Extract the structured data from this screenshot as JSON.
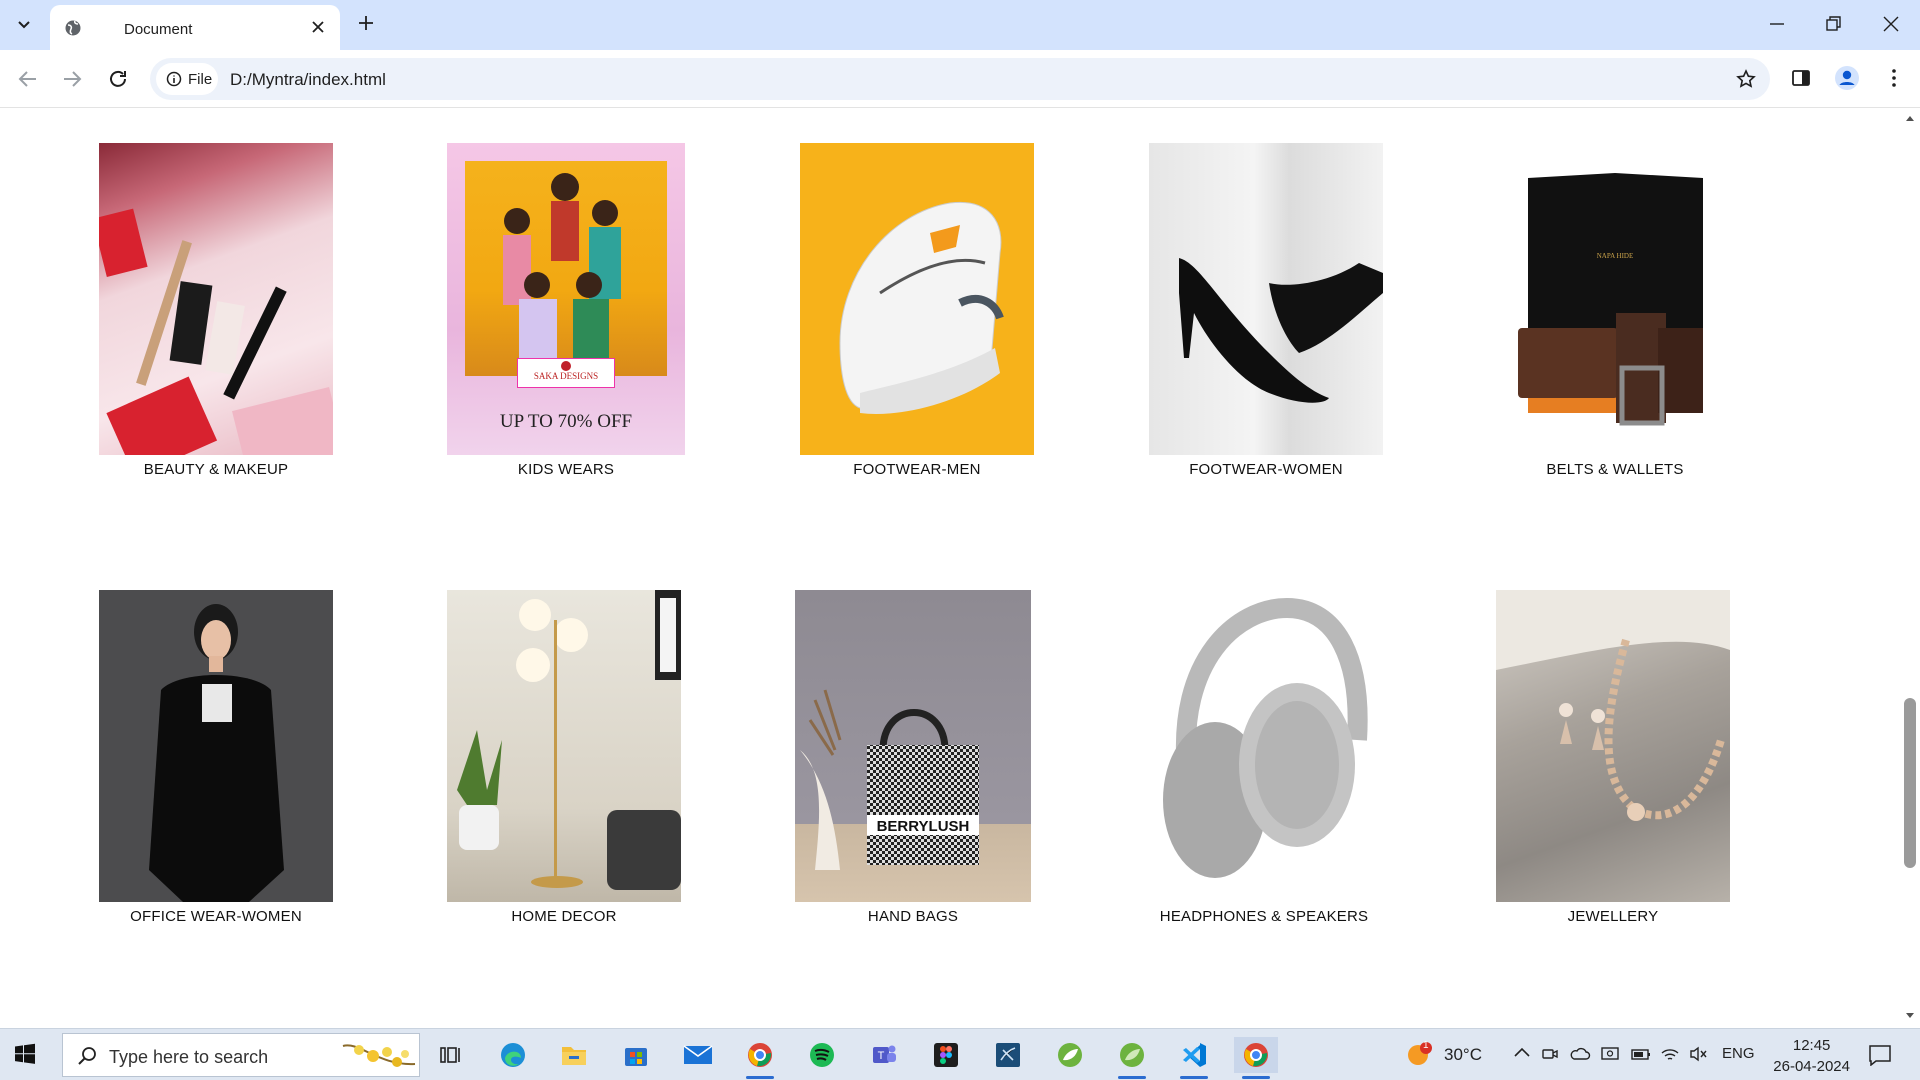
{
  "browser": {
    "tab_title": "Document",
    "address_chip": "File",
    "url": "D:/Myntra/index.html"
  },
  "page": {
    "categories": [
      {
        "label": "BEAUTY & MAKEUP",
        "img": "beauty"
      },
      {
        "label": "KIDS WEARS",
        "img": "kids"
      },
      {
        "label": "FOOTWEAR-MEN",
        "img": "footmen"
      },
      {
        "label": "FOOTWEAR-WOMEN",
        "img": "footwomen"
      },
      {
        "label": "BELTS & WALLETS",
        "img": "belts"
      },
      {
        "label": "OFFICE WEAR-WOMEN",
        "img": "office"
      },
      {
        "label": "HOME DECOR",
        "img": "decor"
      },
      {
        "label": "HAND BAGS",
        "img": "bags"
      },
      {
        "label": "HEADPHONES & SPEAKERS",
        "img": "headphones"
      },
      {
        "label": "JEWELLERY",
        "img": "jewel"
      }
    ],
    "kids_banner": {
      "brand": "SAKA DESIGNS",
      "offer": "UP TO 70% OFF"
    },
    "bag_brand": "BERRYLUSH"
  },
  "taskbar": {
    "search_placeholder": "Type here to search",
    "weather": "30°C",
    "language": "ENG",
    "time": "12:45",
    "date": "26-04-2024",
    "weather_badge": "1"
  },
  "colors": {
    "tabbar": "#d3e3fd",
    "taskbar": "#dfe7f2",
    "accent": "#2b6cd0"
  }
}
